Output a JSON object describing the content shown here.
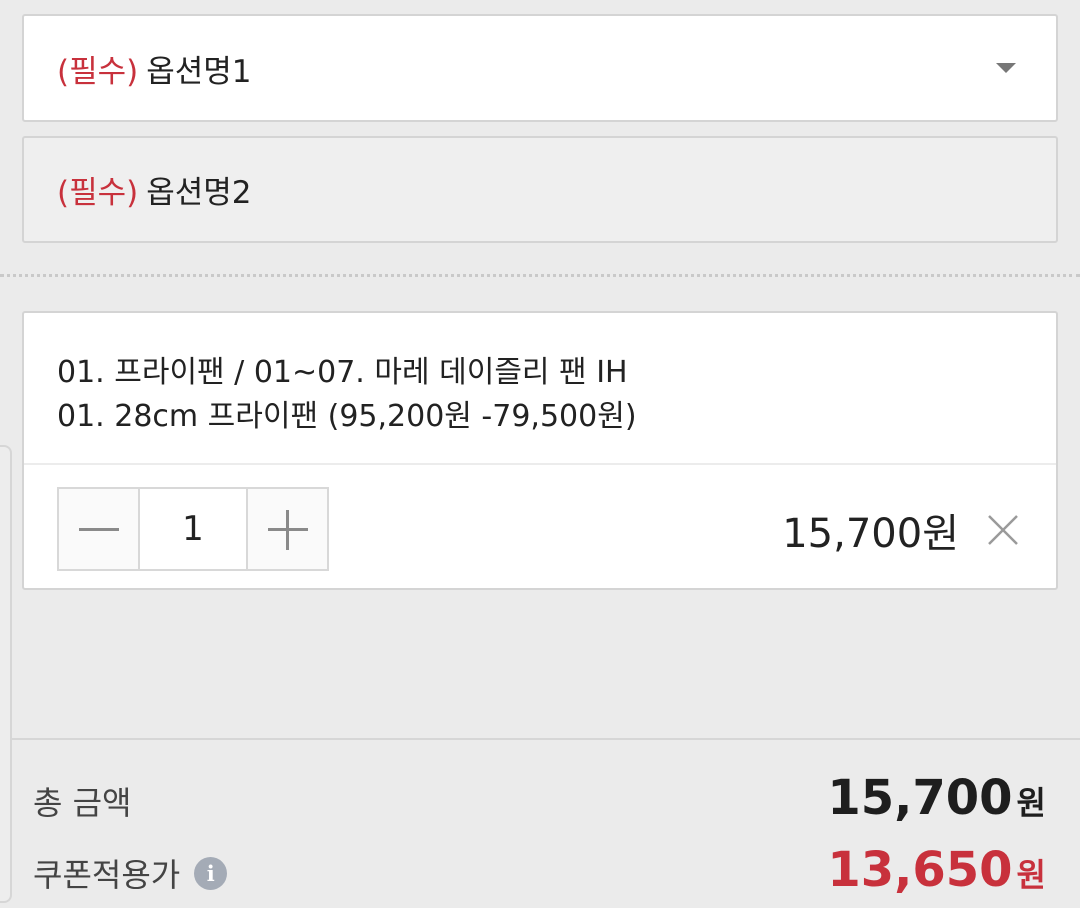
{
  "options": [
    {
      "required_label": "(필수)",
      "name": "옵션명1",
      "state": "active"
    },
    {
      "required_label": "(필수)",
      "name": "옵션명2",
      "state": "disabled"
    }
  ],
  "selected_item": {
    "line1": "01. 프라이팬 / 01~07. 마레 데이즐리 팬 IH",
    "line2": "01. 28cm 프라이팬 (95,200원  -79,500원)",
    "quantity": "1",
    "price": "15,700원"
  },
  "icons": {
    "dropdown": "chevron-down-icon",
    "minus": "minus-icon",
    "plus": "plus-icon",
    "remove": "close-icon",
    "info": "info-icon"
  },
  "totals": {
    "total_label": "총 금액",
    "total_amount": "15,700",
    "total_unit": "원",
    "coupon_label": "쿠폰적용가",
    "info_glyph": "i",
    "coupon_amount": "13,650",
    "coupon_unit": "원"
  },
  "colors": {
    "required": "#c8313c",
    "coupon_price": "#c8313c",
    "background": "#ebebeb"
  }
}
